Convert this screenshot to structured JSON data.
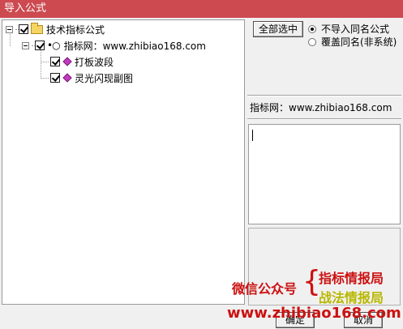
{
  "window": {
    "title": "导入公式"
  },
  "tree": {
    "root": {
      "label": "技术指标公式",
      "checked": true,
      "expanded": true
    },
    "group": {
      "label": "指标网：www.zhibiao168.com",
      "checked": true,
      "expanded": true
    },
    "items": [
      {
        "label": "打板波段",
        "checked": true
      },
      {
        "label": "灵光闪现副图",
        "checked": true
      }
    ]
  },
  "buttons": {
    "select_all": "全部选中",
    "ok": "确定",
    "cancel": "取消"
  },
  "options": {
    "no_import_same_name": {
      "label": "不导入同名公式",
      "selected": true
    },
    "overwrite_same_name": {
      "label": "覆盖同名(非系统)",
      "selected": false
    }
  },
  "panel": {
    "title": "指标网：www.zhibiao168.com",
    "description": ""
  },
  "watermark": {
    "wechat": "微信公众号",
    "brace": "{",
    "line1": "指标情报局",
    "line2": "战法情报局",
    "url": "www.zhibiao168.com"
  },
  "colors": {
    "titlebar": "#cc4a50",
    "watermark_red": "#cc1111",
    "watermark_yellow": "#b8b800"
  }
}
